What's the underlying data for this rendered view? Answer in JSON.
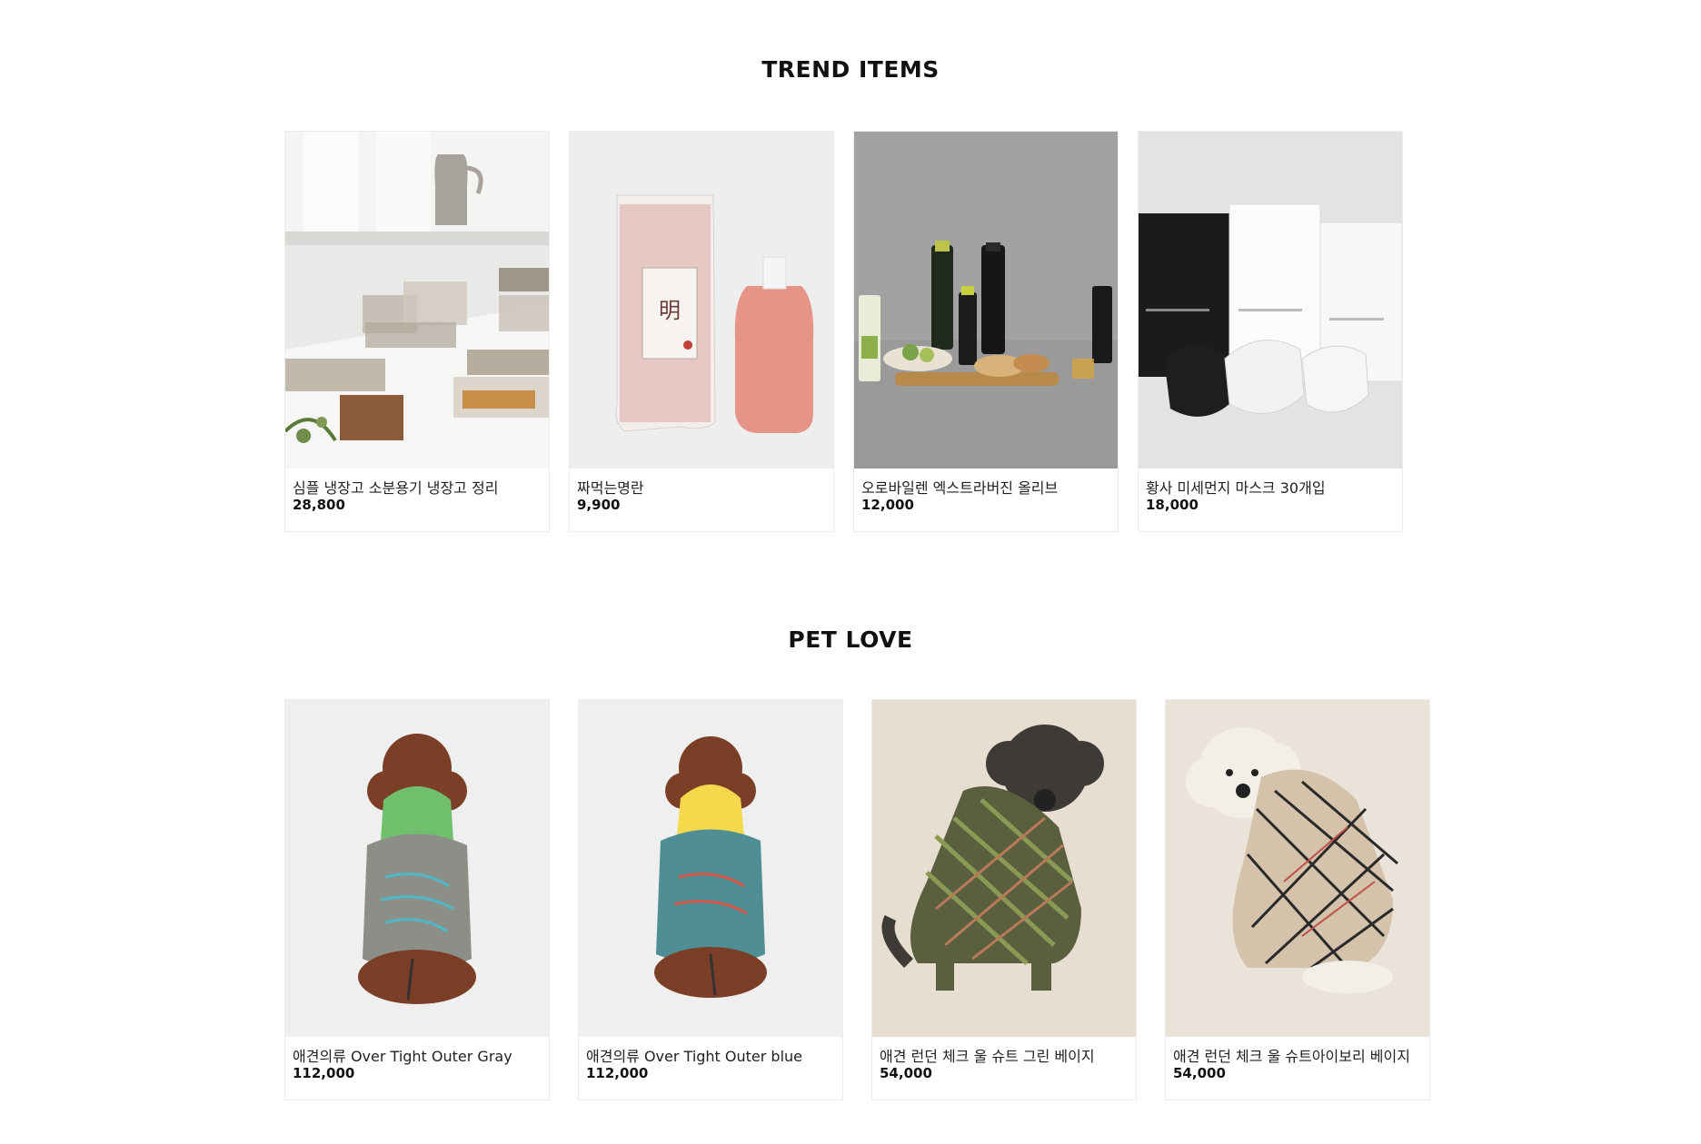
{
  "sections": [
    {
      "title": "TREND ITEMS",
      "products": [
        {
          "name": "심플 냉장고 소분용기 냉장고 정리",
          "price": "28,800",
          "image": "kitchen-containers-photo"
        },
        {
          "name": "짜먹는명란",
          "price": "9,900",
          "image": "myeongran-package-photo"
        },
        {
          "name": "오로바일렌 엑스트라버진 올리브",
          "price": "12,000",
          "image": "olive-oil-bottles-photo"
        },
        {
          "name": "황사 미세먼지 마스크 30개입",
          "price": "18,000",
          "image": "face-mask-boxes-photo"
        }
      ]
    },
    {
      "title": "PET LOVE",
      "products": [
        {
          "name": "애견의류 Over Tight Outer Gray",
          "price": "112,000",
          "image": "dog-gray-jacket-photo"
        },
        {
          "name": "애견의류 Over Tight Outer blue",
          "price": "112,000",
          "image": "dog-blue-jacket-photo"
        },
        {
          "name": "애견 런던 체크 울 슈트 그린 베이지",
          "price": "54,000",
          "image": "dog-green-check-suit-photo"
        },
        {
          "name": "애견 런던 체크 울 슈트아이보리 베이지",
          "price": "54,000",
          "image": "dog-ivory-check-suit-photo"
        }
      ]
    }
  ]
}
